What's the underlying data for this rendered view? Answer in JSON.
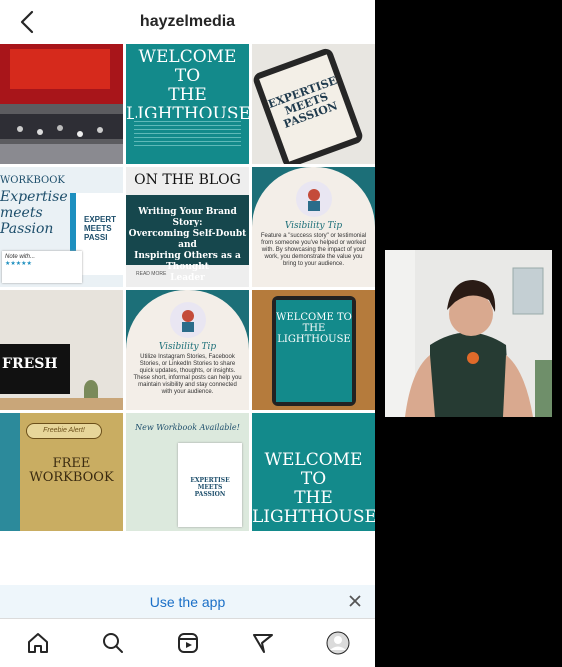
{
  "header": {
    "username": "hayzelmedia",
    "back_icon": "chevron-left-icon"
  },
  "posts": [
    {
      "kind": "photo",
      "desc_icon": "concert-photo"
    },
    {
      "title_line1": "WELCOME TO",
      "title_line2": "THE",
      "title_line3": "LIGHTHOUSE"
    },
    {
      "title_line1": "EXPERTISE",
      "title_line2": "MEETS",
      "title_line3": "PASSION"
    },
    {
      "label_top": "WORKBOOK",
      "title_line1": "Expertise",
      "title_line2": "meets",
      "title_line3": "Passion",
      "side_line1": "EXPERT",
      "side_line2": "MEETS",
      "side_line3": "PASSI",
      "note_title": "Note with...",
      "stars": "★★★★★"
    },
    {
      "header": "ON THE BLOG",
      "line1": "Writing Your Brand Story:",
      "line2": "Overcoming Self-Doubt and",
      "line3": "Inspiring Others as a Thought",
      "line4": "Leader",
      "more": "READ MORE"
    },
    {
      "tip_title": "Visibility Tip",
      "body": "Feature a \"success story\" or testimonial from someone you've helped or worked with. By showcasing the impact of your work, you demonstrate the value you bring to your audience."
    },
    {
      "fresh": "FRESH"
    },
    {
      "tip_title": "Visibility Tip",
      "body": "Utilize Instagram Stories, Facebook Stories, or LinkedIn Stories to share quick updates, thoughts, or insights. These short, informal posts can help you maintain visibility and stay connected with your audience."
    },
    {
      "title_line1": "WELCOME TO",
      "title_line2": "THE",
      "title_line3": "LIGHTHOUSE"
    },
    {
      "badge": "Freebie Alert!",
      "title_line1": "FREE",
      "title_line2": "WORKBOOK"
    },
    {
      "heading": "New Workbook Available!",
      "title_line1": "EXPERTISE",
      "title_line2": "MEETS",
      "title_line3": "PASSION"
    },
    {
      "title_line1": "WELCOME TO",
      "title_line2": "THE",
      "title_line3": "LIGHTHOUSE"
    }
  ],
  "banner": {
    "use_app": "Use the app",
    "close_icon": "close-icon"
  },
  "nav": {
    "home": "home-icon",
    "search": "search-icon",
    "reels": "reels-icon",
    "messages": "send-icon",
    "profile": "avatar-icon"
  },
  "colors": {
    "teal": "#17878a",
    "link": "#1a6fc7",
    "banner_bg": "#eef6fb"
  }
}
